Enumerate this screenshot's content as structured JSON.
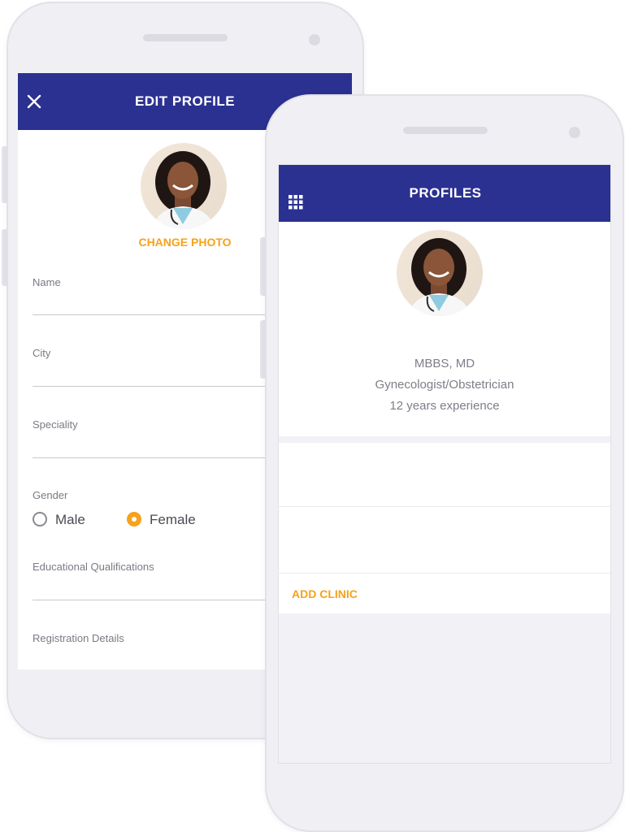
{
  "edit_profile": {
    "title": "EDIT PROFILE",
    "close_icon": "close-icon",
    "change_photo": "CHANGE PHOTO",
    "fields": [
      {
        "label": "Name",
        "value": ""
      },
      {
        "label": "City",
        "value": ""
      },
      {
        "label": "Speciality",
        "value": ""
      }
    ],
    "gender": {
      "label": "Gender",
      "options": [
        {
          "label": "Male",
          "selected": false
        },
        {
          "label": "Female",
          "selected": true
        }
      ]
    },
    "education_label": "Educational Qualifications",
    "registration_label": "Registration Details"
  },
  "profiles": {
    "title": "PROFILES",
    "menu_icon": "grid-menu-icon",
    "degree": "MBBS, MD",
    "specialty": "Gynecologist/Obstetrician",
    "experience": "12 years experience",
    "add_clinic": "ADD CLINIC"
  },
  "colors": {
    "appbar": "#2b3191",
    "accent": "#f6a21a",
    "phone_body": "#f0eff4"
  }
}
